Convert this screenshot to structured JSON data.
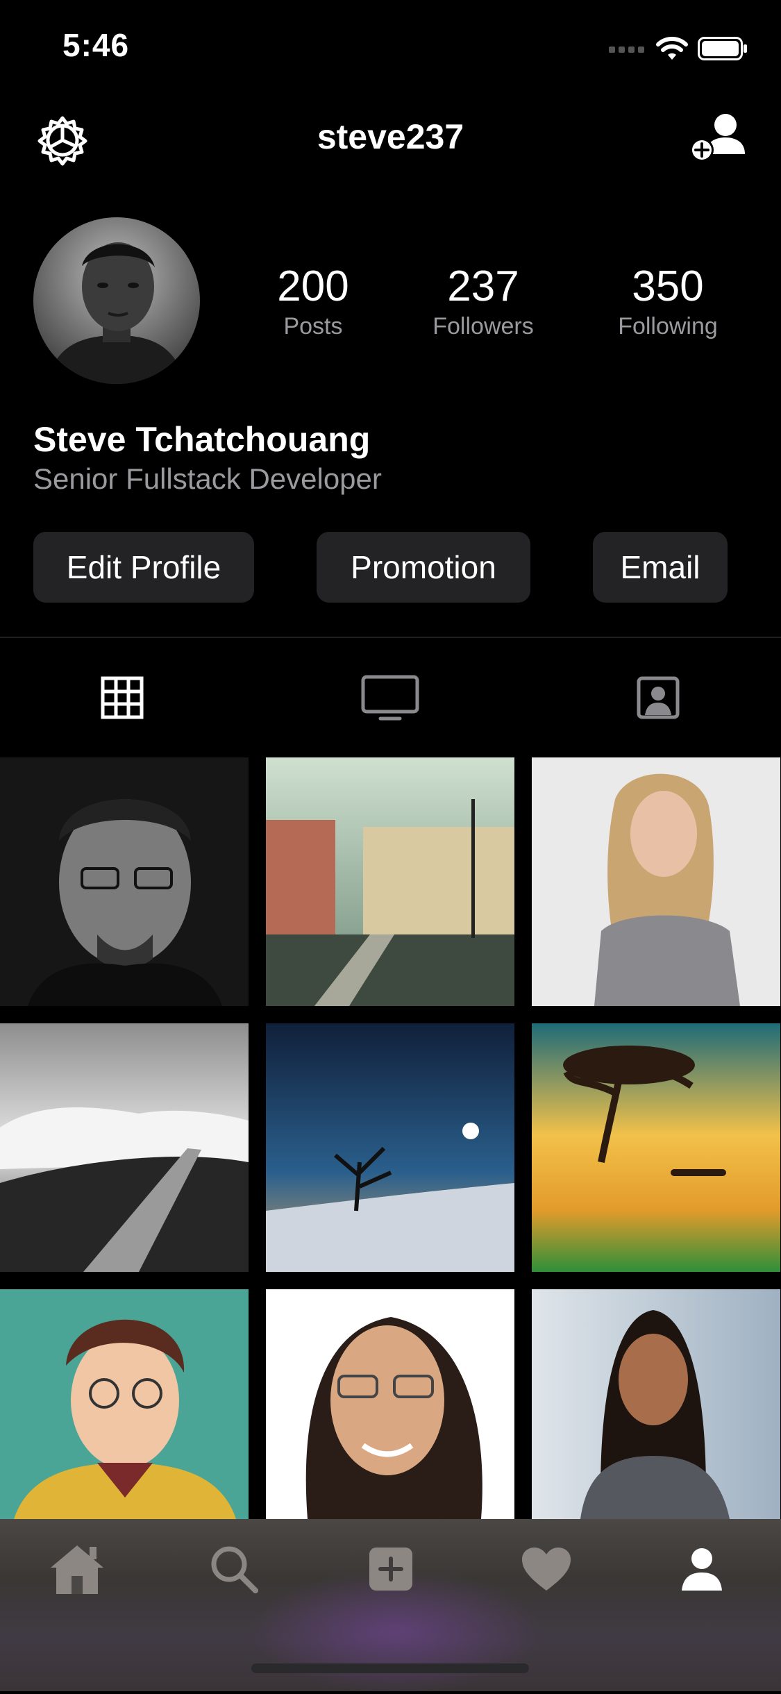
{
  "status_bar": {
    "time": "5:46"
  },
  "header": {
    "username": "steve237"
  },
  "profile": {
    "name": "Steve Tchatchouang",
    "bio": "Senior Fullstack Developer",
    "stats": [
      {
        "value": "200",
        "label": "Posts"
      },
      {
        "value": "237",
        "label": "Followers"
      },
      {
        "value": "350",
        "label": "Following"
      }
    ],
    "buttons": {
      "edit": "Edit Profile",
      "promotion": "Promotion",
      "email": "Email"
    }
  },
  "tabs": {
    "selected": "grid",
    "items": [
      "grid-icon",
      "tv-icon",
      "tagged-person-icon"
    ]
  },
  "tabbar": {
    "selected": "profile",
    "items": [
      "home-icon",
      "search-icon",
      "add-post-icon",
      "heart-icon",
      "profile-icon"
    ]
  },
  "colors": {
    "background": "#000000",
    "button_bg": "#232325",
    "secondary_text": "#9a9a9f"
  }
}
